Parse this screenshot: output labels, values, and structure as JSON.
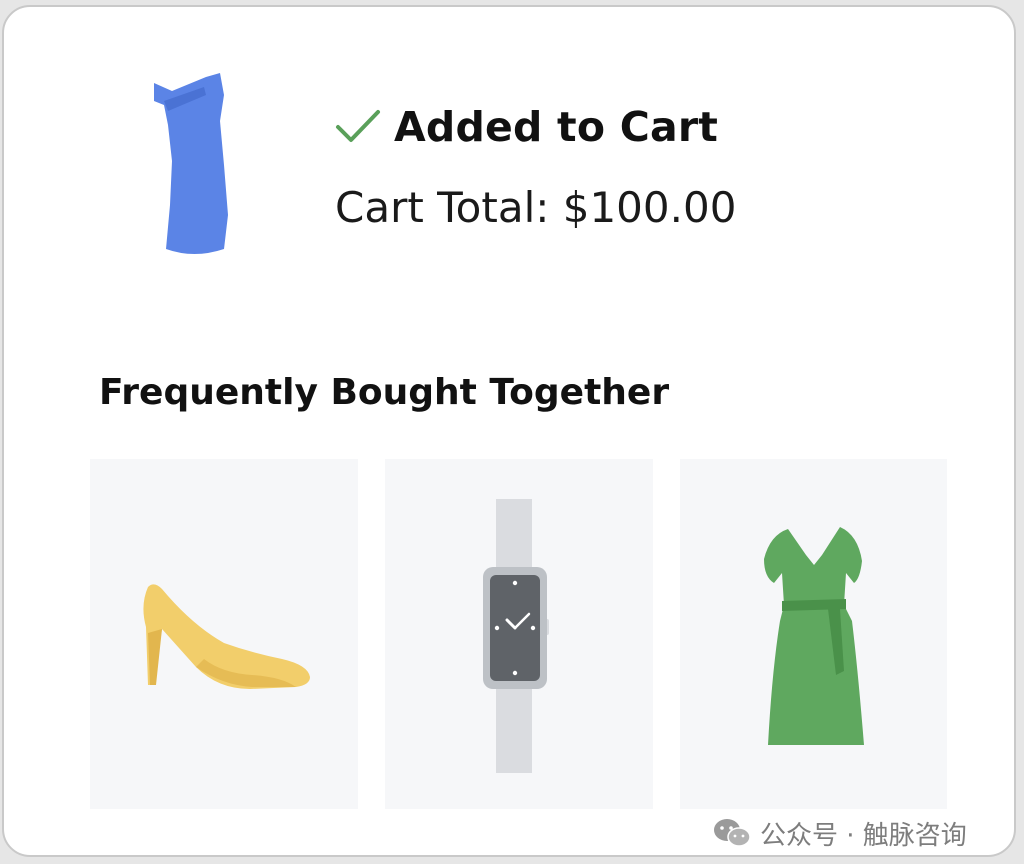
{
  "confirmation": {
    "icon": "check-icon",
    "title": "Added to Cart",
    "cart_total": "Cart Total: $100.00",
    "product_icon": "blue-dress-icon"
  },
  "recommendations": {
    "heading": "Frequently Bought Together",
    "items": [
      {
        "icon": "high-heel-shoe-icon"
      },
      {
        "icon": "wristwatch-icon"
      },
      {
        "icon": "green-dress-icon"
      }
    ]
  },
  "watermark": {
    "icon": "wechat-icon",
    "text": "公众号 · 触脉咨询"
  },
  "colors": {
    "check": "#5aa05a",
    "blue_dress": "#5b84e6",
    "shoe": "#f2ce6b",
    "watch_body": "#5f6368",
    "green_dress": "#5fa85f"
  }
}
